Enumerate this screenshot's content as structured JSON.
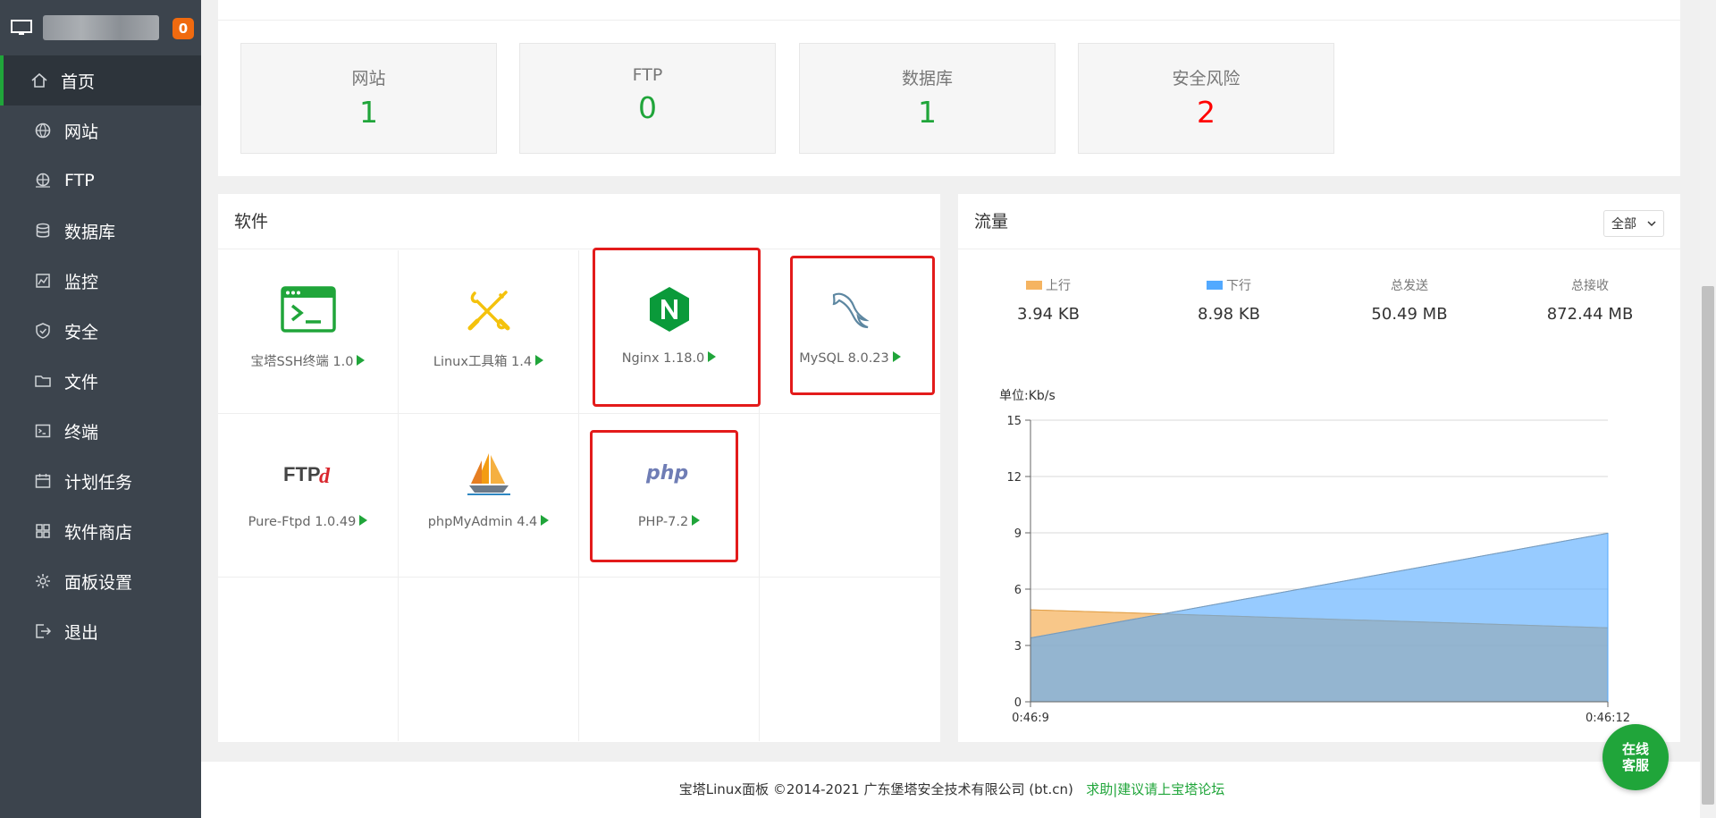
{
  "sidebar": {
    "badge": "0",
    "items": [
      {
        "label": "首页",
        "icon": "home-icon",
        "active": true
      },
      {
        "label": "网站",
        "icon": "globe-icon"
      },
      {
        "label": "FTP",
        "icon": "ftp-icon"
      },
      {
        "label": "数据库",
        "icon": "database-icon"
      },
      {
        "label": "监控",
        "icon": "monitor-chart-icon"
      },
      {
        "label": "安全",
        "icon": "shield-icon"
      },
      {
        "label": "文件",
        "icon": "folder-icon"
      },
      {
        "label": "终端",
        "icon": "terminal-icon"
      },
      {
        "label": "计划任务",
        "icon": "calendar-icon"
      },
      {
        "label": "软件商店",
        "icon": "grid-icon"
      },
      {
        "label": "面板设置",
        "icon": "gear-icon"
      },
      {
        "label": "退出",
        "icon": "logout-icon"
      }
    ]
  },
  "stats": [
    {
      "label": "网站",
      "value": "1"
    },
    {
      "label": "FTP",
      "value": "0"
    },
    {
      "label": "数据库",
      "value": "1"
    },
    {
      "label": "安全风险",
      "value": "2"
    }
  ],
  "software": {
    "title": "软件",
    "items": [
      {
        "label": "宝塔SSH终端 1.0",
        "icon": "ssh-terminal-icon"
      },
      {
        "label": "Linux工具箱 1.4",
        "icon": "toolbox-icon"
      },
      {
        "label": "Nginx 1.18.0",
        "icon": "nginx-icon"
      },
      {
        "label": "MySQL 8.0.23",
        "icon": "mysql-dolphin-icon"
      },
      {
        "label": "Pure-Ftpd 1.0.49",
        "icon": "ftpd-logo-icon"
      },
      {
        "label": "phpMyAdmin 4.4",
        "icon": "phpmyadmin-sailboat-icon"
      },
      {
        "label": "PHP-7.2",
        "icon": "php-logo-icon"
      }
    ],
    "ftpd_logo_text": "FTPd",
    "php_logo_text": "php"
  },
  "traffic": {
    "title": "流量",
    "select_value": "全部",
    "stats": [
      {
        "label": "上行",
        "value": "3.94 KB",
        "color": "#f5b461"
      },
      {
        "label": "下行",
        "value": "8.98 KB",
        "color": "#52a9ff"
      },
      {
        "label": "总发送",
        "value": "50.49 MB"
      },
      {
        "label": "总接收",
        "value": "872.44 MB"
      }
    ]
  },
  "chart_data": {
    "type": "area",
    "ylabel": "单位:Kb/s",
    "ylim": [
      0,
      15
    ],
    "yticks": [
      0,
      3,
      6,
      9,
      12,
      15
    ],
    "x": [
      "0:46:9",
      "0:46:12"
    ],
    "series": [
      {
        "name": "上行",
        "values": [
          4.9,
          3.94
        ],
        "color": "#f5b461"
      },
      {
        "name": "下行",
        "values": [
          3.4,
          8.98
        ],
        "color": "#52a9ff"
      }
    ],
    "grid": true
  },
  "footer": {
    "copyright": "宝塔Linux面板 ©2014-2021 广东堡塔安全技术有限公司 (bt.cn)",
    "link": "求助|建议请上宝塔论坛"
  },
  "service_button": {
    "line1": "在线",
    "line2": "客服"
  }
}
